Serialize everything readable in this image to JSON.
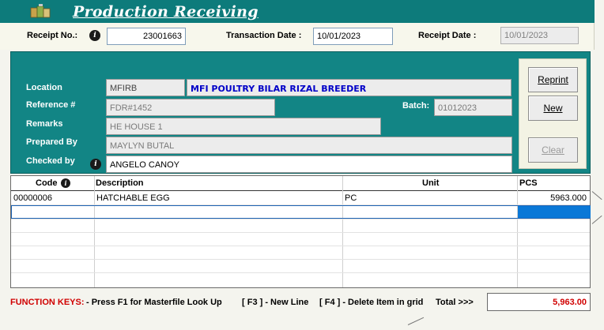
{
  "window": {
    "title": "Production Receiving",
    "icon": "boxes-icon",
    "accent": "#128585"
  },
  "header": {
    "receipt_no_label": "Receipt No.:",
    "receipt_no_value": "23001663",
    "transaction_date_label": "Transaction Date :",
    "transaction_date_value": "10/01/2023",
    "receipt_date_label": "Receipt Date :",
    "receipt_date_value": "10/01/2023"
  },
  "form": {
    "location_label": "Location",
    "location_code": "MFIRB",
    "location_name": "MFI POULTRY BILAR RIZAL BREEDER",
    "reference_label": "Reference #",
    "reference_value": "FDR#1452",
    "batch_label": "Batch:",
    "batch_value": "01012023",
    "remarks_label": "Remarks",
    "remarks_value": "HE HOUSE 1",
    "prepared_by_label": "Prepared By",
    "prepared_by_value": "MAYLYN BUTAL",
    "checked_by_label": "Checked by",
    "checked_by_value": "ANGELO CANOY"
  },
  "buttons": {
    "reprint": "Reprint",
    "new": "New",
    "clear": "Clear"
  },
  "grid": {
    "columns": [
      "Code",
      "Description",
      "Unit",
      "PCS"
    ],
    "rows": [
      {
        "code": "00000006",
        "description": "HATCHABLE EGG",
        "unit": "PC",
        "pcs": "5963.000"
      }
    ]
  },
  "footer": {
    "function_keys_label": "FUNCTION KEYS:",
    "f1_text": "- Press F1 for Masterfile Look Up",
    "f3_text": "[ F3 ] - New Line",
    "f4_text": "[ F4 ] - Delete Item in grid",
    "total_label": "Total >>>",
    "total_value": "5,963.00"
  }
}
